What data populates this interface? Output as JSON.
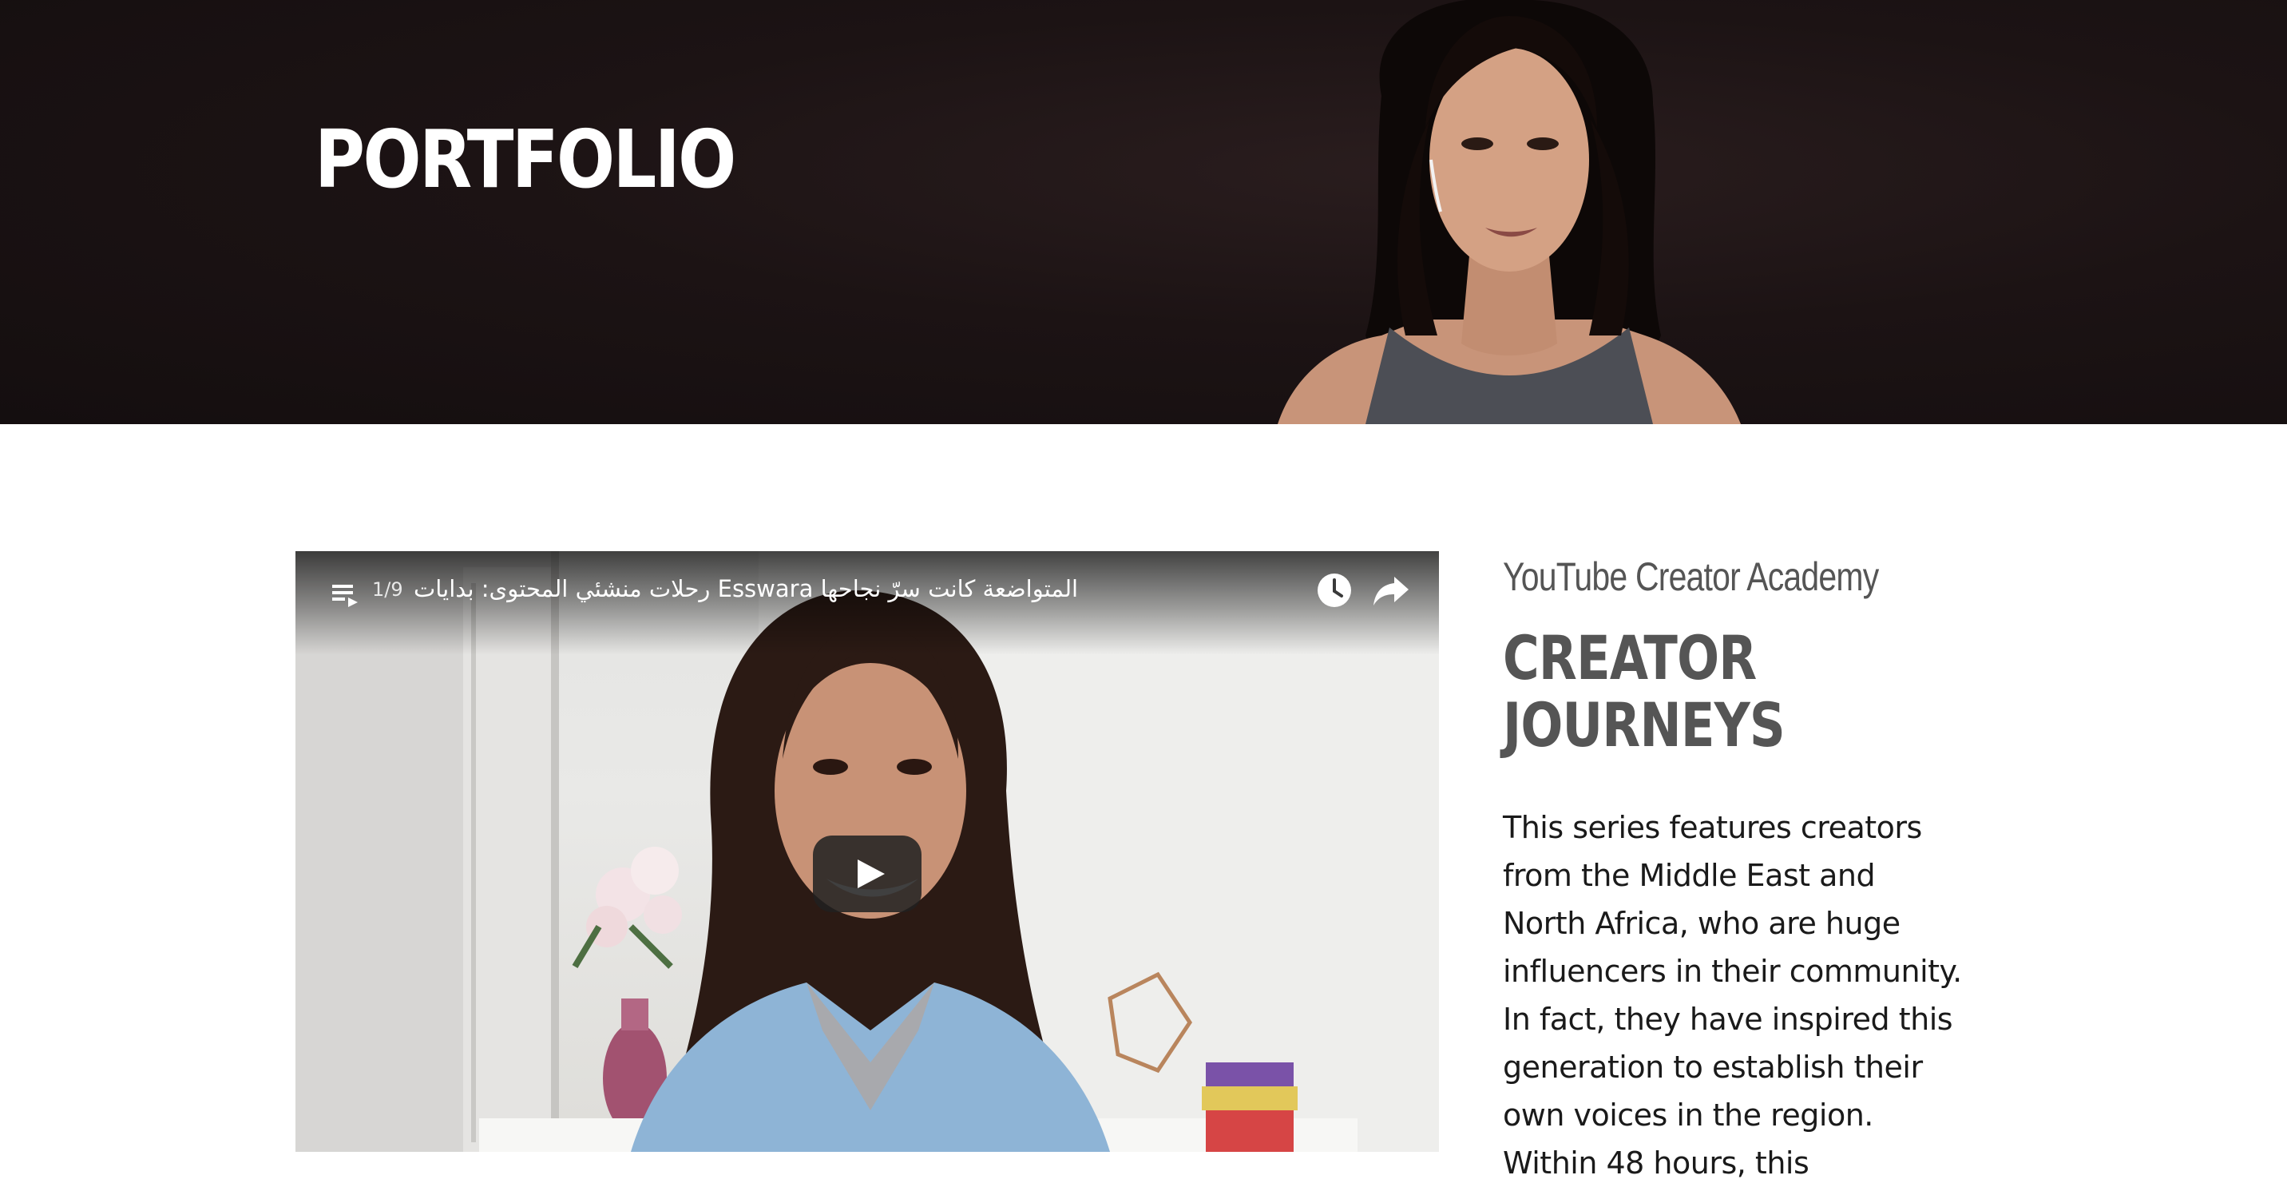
{
  "hero": {
    "title": "PORTFOLIO"
  },
  "video": {
    "playlist_count": "1/9",
    "title": "المتواضعة كانت سرّ نجاحها Esswara رحلات منشئي المحتوى: بدايات"
  },
  "side": {
    "subtitle": "YouTube Creator Academy",
    "heading_line1": "CREATOR",
    "heading_line2": "JOURNEYS",
    "body": "This series features creators from the Middle East and North Africa, who are huge influencers in their community. In fact, they have inspired this generation to establish their own voices in the region. Within 48 hours, this"
  },
  "colors": {
    "hero_background": "#1c1314",
    "heading_gray": "#555555",
    "body_text": "#1a1a1a"
  },
  "icons": [
    "playlist-icon",
    "watch-later-icon",
    "share-icon",
    "play-icon"
  ]
}
